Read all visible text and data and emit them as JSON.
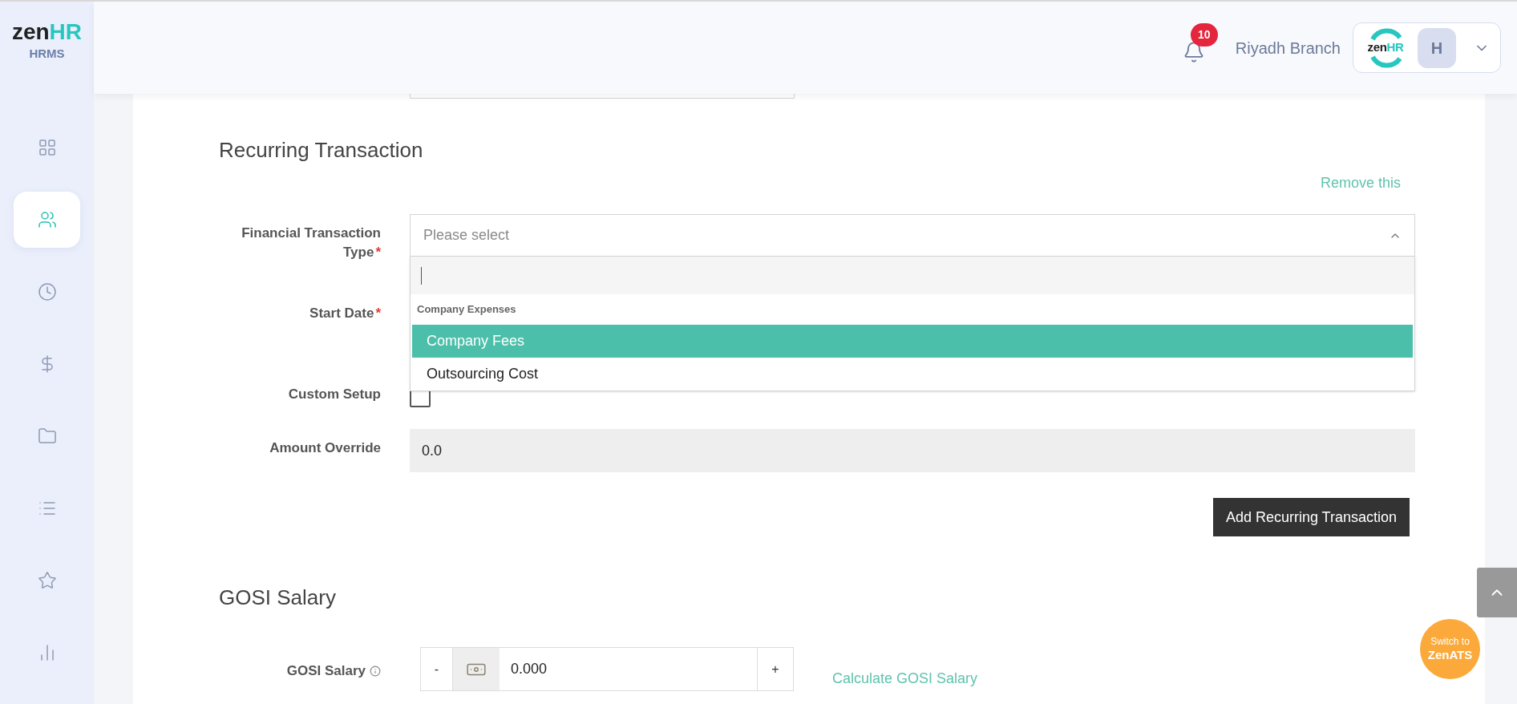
{
  "brand": {
    "logo_main": "zen",
    "logo_accent": "HR",
    "product": "HRMS"
  },
  "sidebar": {
    "items": [
      {
        "kind": "dashboard",
        "selected": false
      },
      {
        "kind": "people",
        "selected": true
      },
      {
        "kind": "time",
        "selected": false
      },
      {
        "kind": "payroll",
        "selected": false
      },
      {
        "kind": "documents",
        "selected": false
      },
      {
        "kind": "lists",
        "selected": false
      },
      {
        "kind": "favorites",
        "selected": false
      },
      {
        "kind": "reports",
        "selected": false
      }
    ]
  },
  "header": {
    "notification_count": "10",
    "branch": "Riyadh Branch",
    "company_logo": {
      "main": "zen",
      "accent": "HR"
    },
    "avatar_initial": "H"
  },
  "recurring_transaction": {
    "title": "Recurring Transaction",
    "remove_link": "Remove this",
    "fields": [
      {
        "kind": "select",
        "label": "Financial Transaction Type",
        "required_mark": "*",
        "placeholder": "Please select",
        "expanded": true,
        "groups": [
          {
            "label": "Company Expenses",
            "options": [
              {
                "label": "Company Fees",
                "selected": true
              },
              {
                "label": "Outsourcing Cost",
                "selected": false
              }
            ]
          }
        ]
      },
      {
        "kind": "date",
        "label": "Start Date",
        "required_mark": "*"
      },
      {
        "kind": "checkbox",
        "label": "Custom Setup",
        "checked": false
      },
      {
        "kind": "text",
        "label": "Amount Override",
        "value": "0.0",
        "disabled": true
      }
    ],
    "submit_button": "Add Recurring Transaction"
  },
  "gosi_salary": {
    "title": "GOSI Salary",
    "field": {
      "label": "GOSI Salary",
      "decrement": "-",
      "value": "0.000",
      "increment": "+"
    },
    "calculate_link": "Calculate GOSI Salary"
  },
  "switch_button": {
    "line1": "Switch to",
    "line2": "ZenATS"
  }
}
